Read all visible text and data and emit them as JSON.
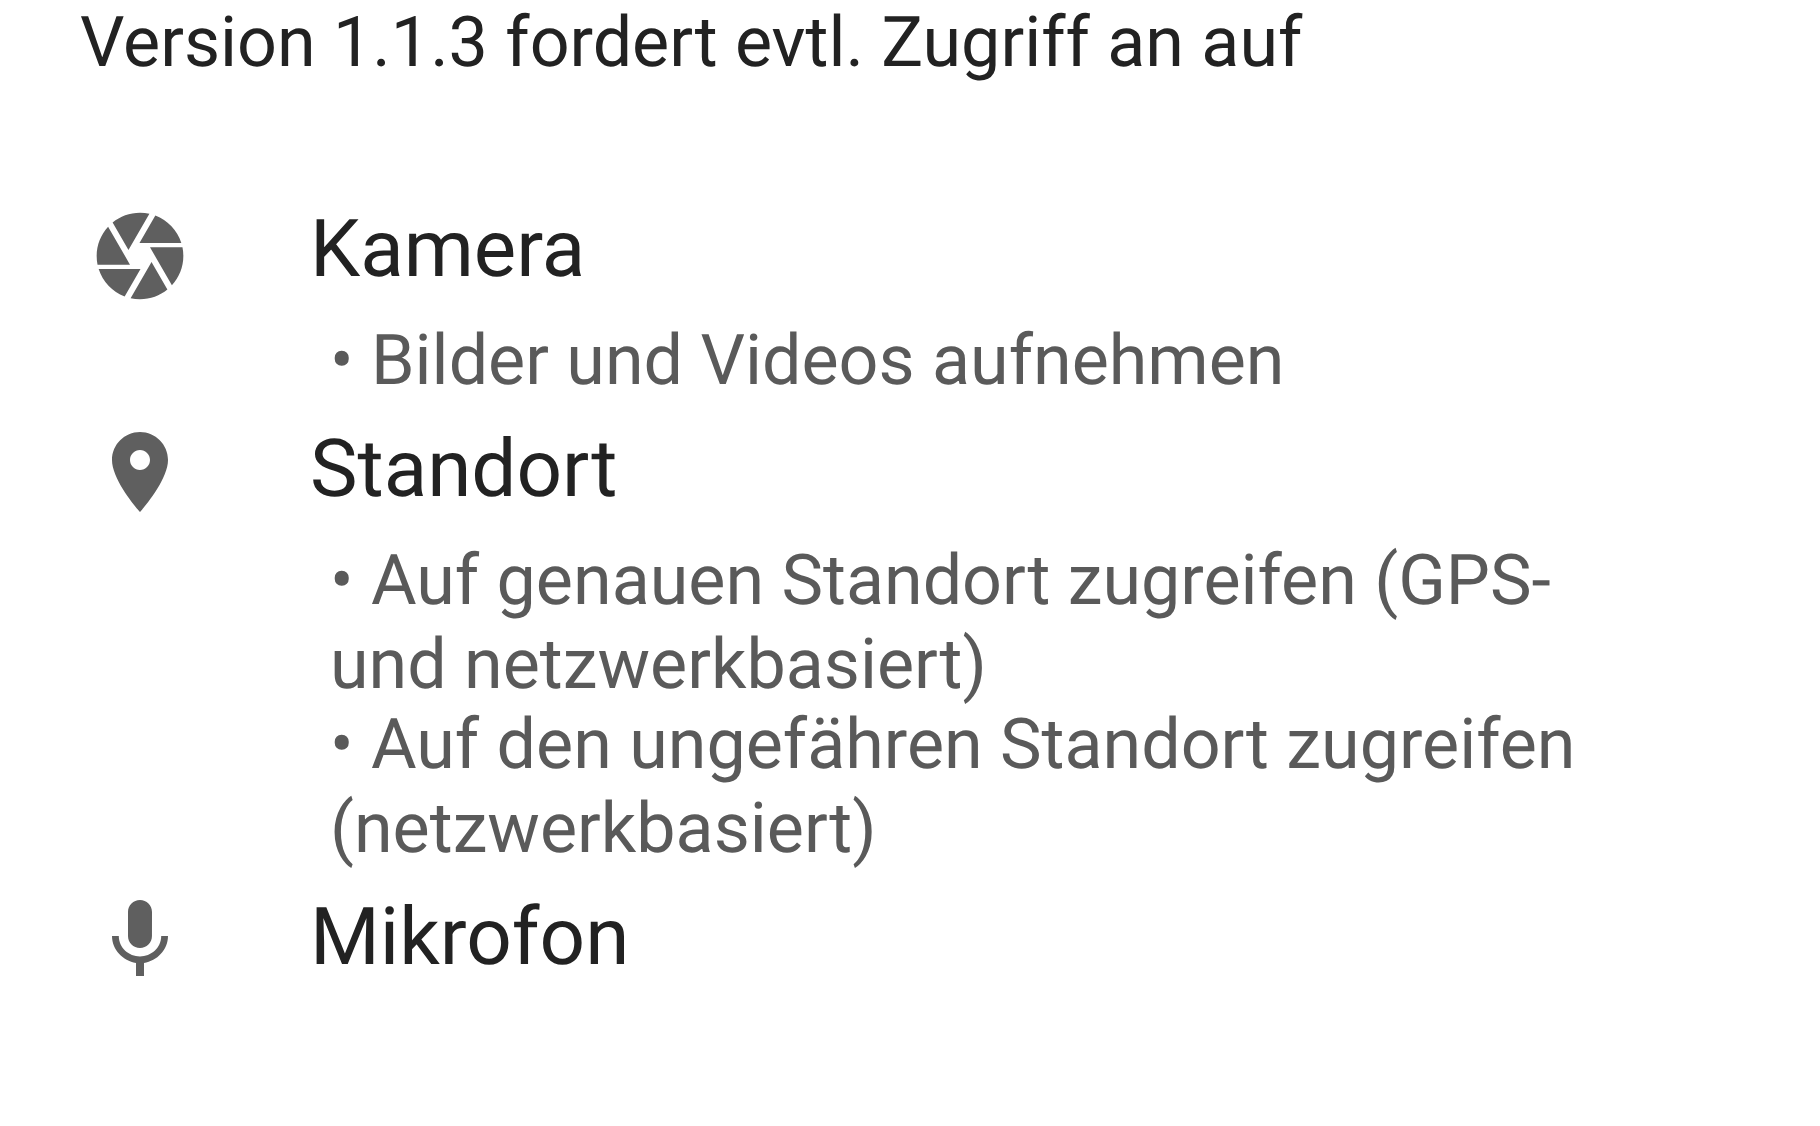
{
  "heading": "Version 1.1.3 fordert evtl. Zugriff an auf",
  "groups": [
    {
      "kind": "camera",
      "title": "Kamera",
      "items": [
        "• Bilder und Videos aufnehmen"
      ]
    },
    {
      "kind": "location",
      "title": "Standort",
      "items": [
        "• Auf genauen Standort zugreifen (GPS- und netzwerkbasiert)",
        "• Auf den ungefähren Standort zugreifen (netzwerkbasiert)"
      ]
    },
    {
      "kind": "microphone",
      "title": "Mikrofon"
    }
  ]
}
